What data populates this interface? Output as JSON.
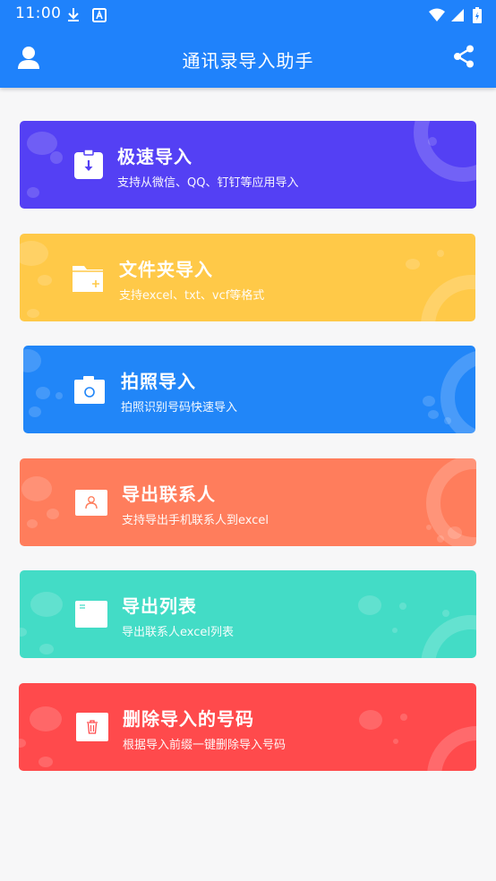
{
  "status": {
    "time": "11:00",
    "icons": [
      "download-icon",
      "a-notification-icon"
    ],
    "right_icons": [
      "wifi-icon",
      "signal-icon",
      "battery-icon"
    ]
  },
  "header": {
    "title": "通讯录导入助手",
    "left_icon": "user-icon",
    "right_icon": "share-icon",
    "background": "#1f82fb"
  },
  "cards": [
    {
      "id": "quick-import",
      "title": "极速导入",
      "subtitle": "支持从微信、QQ、钉钉等应用导入",
      "color": "#5440f4",
      "icon": "download-clipboard-icon"
    },
    {
      "id": "folder-import",
      "title": "文件夹导入",
      "subtitle": "支持excel、txt、vcf等格式",
      "color": "#ffc948",
      "icon": "folder-icon"
    },
    {
      "id": "photo-import",
      "title": "拍照导入",
      "subtitle": "拍照识别号码快速导入",
      "color": "#2186f8",
      "icon": "camera-icon"
    },
    {
      "id": "export-contacts",
      "title": "导出联系人",
      "subtitle": "支持导出手机联系人到excel",
      "color": "#ff7d5c",
      "icon": "contact-card-icon"
    },
    {
      "id": "export-list",
      "title": "导出列表",
      "subtitle": "导出联系人excel列表",
      "color": "#43dcc6",
      "icon": "list-document-icon"
    },
    {
      "id": "delete-imported",
      "title": "删除导入的号码",
      "subtitle": "根据导入前缀一键删除导入号码",
      "color": "#ff4a4c",
      "icon": "trash-icon"
    }
  ]
}
